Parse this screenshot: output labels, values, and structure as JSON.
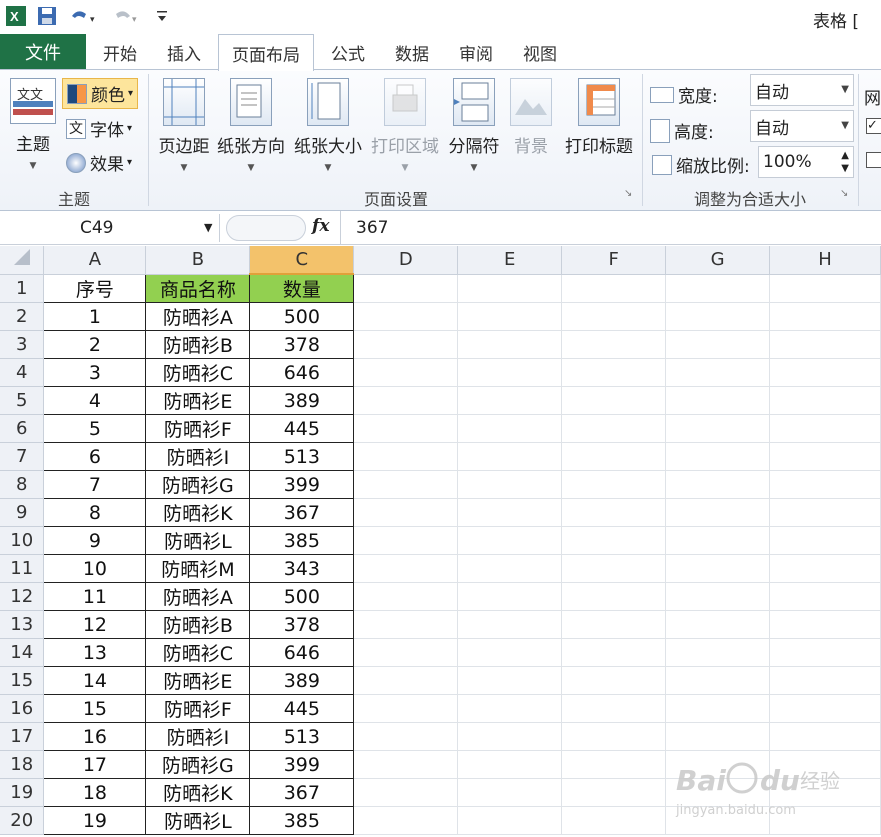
{
  "titlebar": {
    "title": "表格 ["
  },
  "tabs": [
    {
      "label": "文件"
    },
    {
      "label": "开始"
    },
    {
      "label": "插入"
    },
    {
      "label": "页面布局"
    },
    {
      "label": "公式"
    },
    {
      "label": "数据"
    },
    {
      "label": "审阅"
    },
    {
      "label": "视图"
    }
  ],
  "ribbon": {
    "theme_group": {
      "label": "主题",
      "theme_button": "主题",
      "colors": "颜色",
      "fonts": "字体",
      "effects": "效果"
    },
    "page_setup_group": {
      "label": "页面设置",
      "margins": "页边距",
      "orientation": "纸张方向",
      "size": "纸张大小",
      "print_area": "打印区域",
      "breaks": "分隔符",
      "background": "背景",
      "print_titles": "打印标题"
    },
    "scale_group": {
      "label": "调整为合适大小",
      "width_label": "宽度:",
      "width_value": "自动",
      "height_label": "高度:",
      "height_value": "自动",
      "scale_label": "缩放比例:",
      "scale_value": "100%"
    },
    "sheet_options": {
      "gridlines_label": "网"
    }
  },
  "formula_bar": {
    "name_box": "C49",
    "fx": "fx",
    "value": "367"
  },
  "grid": {
    "columns": [
      "A",
      "B",
      "C",
      "D",
      "E",
      "F",
      "G",
      "H"
    ],
    "header_row": [
      "序号",
      "商品名称",
      "数量"
    ],
    "rows": [
      [
        "1",
        "防晒衫A",
        "500"
      ],
      [
        "2",
        "防晒衫B",
        "378"
      ],
      [
        "3",
        "防晒衫C",
        "646"
      ],
      [
        "4",
        "防晒衫E",
        "389"
      ],
      [
        "5",
        "防晒衫F",
        "445"
      ],
      [
        "6",
        "防晒衫I",
        "513"
      ],
      [
        "7",
        "防晒衫G",
        "399"
      ],
      [
        "8",
        "防晒衫K",
        "367"
      ],
      [
        "9",
        "防晒衫L",
        "385"
      ],
      [
        "10",
        "防晒衫M",
        "343"
      ],
      [
        "11",
        "防晒衫A",
        "500"
      ],
      [
        "12",
        "防晒衫B",
        "378"
      ],
      [
        "13",
        "防晒衫C",
        "646"
      ],
      [
        "14",
        "防晒衫E",
        "389"
      ],
      [
        "15",
        "防晒衫F",
        "445"
      ],
      [
        "16",
        "防晒衫I",
        "513"
      ],
      [
        "17",
        "防晒衫G",
        "399"
      ],
      [
        "18",
        "防晒衫K",
        "367"
      ],
      [
        "19",
        "防晒衫L",
        "385"
      ]
    ]
  },
  "watermark": {
    "brand": "Bai du 经验",
    "url": "jingyan.baidu.com"
  },
  "colors": {
    "file_tab": "#1f7246",
    "header_fill": "#92d050",
    "selected_col": "#f3c26b",
    "annotation": "#d9202a"
  }
}
